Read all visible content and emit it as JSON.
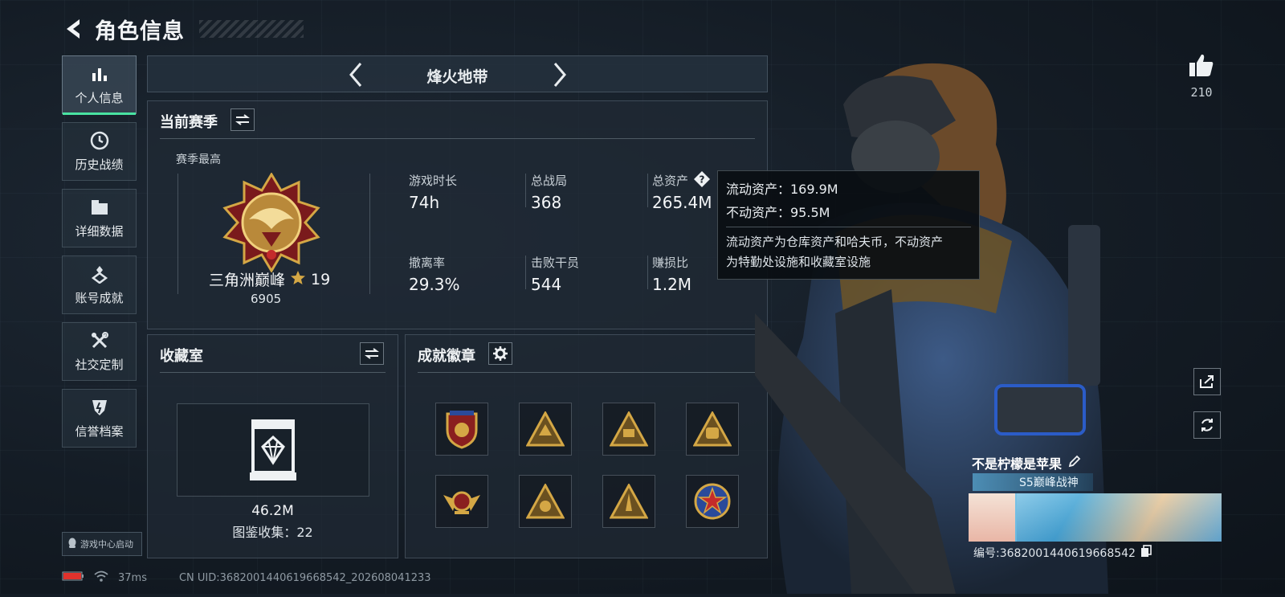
{
  "header": {
    "title": "角色信息"
  },
  "sidebar": {
    "items": [
      {
        "label": "个人信息",
        "icon": "bar-chart-icon",
        "active": true
      },
      {
        "label": "历史战绩",
        "icon": "clock-icon"
      },
      {
        "label": "详细数据",
        "icon": "folder-icon"
      },
      {
        "label": "账号成就",
        "icon": "achievement-icon"
      },
      {
        "label": "社交定制",
        "icon": "tools-icon"
      },
      {
        "label": "信誉档案",
        "icon": "shield-icon"
      }
    ],
    "launch_label": "游戏中心启动"
  },
  "mode_bar": {
    "title": "烽火地带"
  },
  "season": {
    "title": "当前赛季",
    "peak_label": "赛季最高",
    "rank_name": "三角洲巅峰",
    "rank_stars": "19",
    "rank_score": "6905",
    "stats": [
      {
        "label": "游戏时长",
        "value": "74h"
      },
      {
        "label": "总战局",
        "value": "368"
      },
      {
        "label": "总资产",
        "value": "265.4M"
      },
      {
        "label": "撤离率",
        "value": "29.3%"
      },
      {
        "label": "击败干员",
        "value": "544"
      },
      {
        "label": "赚损比",
        "value": "1.2M"
      }
    ]
  },
  "tooltip": {
    "liquid": "流动资产：169.9M",
    "fixed": "不动资产：95.5M",
    "desc_line1": "流动资产为仓库资产和哈夫币，不动资产",
    "desc_line2": "为特勤处设施和收藏室设施"
  },
  "collection": {
    "title": "收藏室",
    "value": "46.2M",
    "count_label": "图鉴收集：22"
  },
  "achievements": {
    "title": "成就徽章",
    "badges": [
      "badge-eagle-icon",
      "badge-triangle-icon",
      "badge-triangle-56-icon",
      "badge-triangle-bag-icon",
      "badge-wings-icon",
      "badge-triangle-crest-icon",
      "badge-triangle-rocket-icon",
      "badge-star-round-icon"
    ]
  },
  "profile": {
    "likes": "210",
    "player_name": "不是柠檬是苹果",
    "title_badge": "S5巅峰战神",
    "uid_line": "编号:3682001440619668542"
  },
  "status": {
    "ping": "37ms",
    "uid_text": "CN UID:3682001440619668542_202608041233"
  },
  "colors": {
    "accent": "#49e3a2",
    "gold": "#d4a745",
    "battery": "#e0322c"
  }
}
